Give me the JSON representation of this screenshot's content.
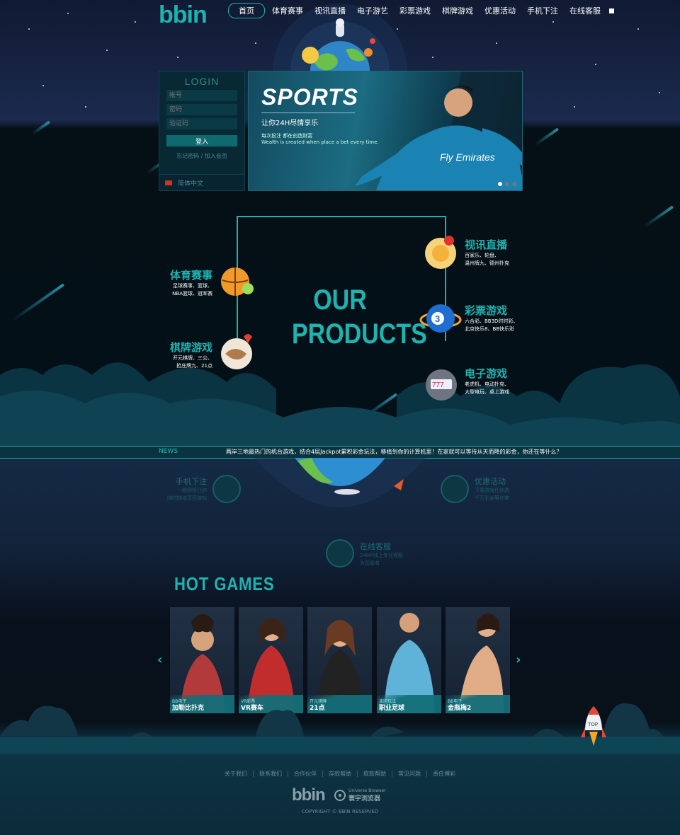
{
  "header": {
    "logo_text": "bbin",
    "nav": [
      "首页",
      "体育赛事",
      "视讯直播",
      "电子游艺",
      "彩票游戏",
      "棋牌游戏",
      "优惠活动",
      "手机下注",
      "在线客服"
    ]
  },
  "login": {
    "title": "LOGIN",
    "account_placeholder": "帐号",
    "password_placeholder": "密码",
    "captcha_placeholder": "验证码",
    "submit_label": "登入",
    "links": "忘记密码 / 加入会员",
    "language": "简体中文"
  },
  "banner": {
    "title": "SPORTS",
    "subtitle": "让你24H尽情享乐",
    "line1": "每次投注 都在创造财富",
    "line2": "Wealth is created when place a bet every time.",
    "shirt_text": "Fly Emirates"
  },
  "products": {
    "heading_line1": "OUR",
    "heading_line2": "PRODUCTS",
    "sports": {
      "title": "体育赛事",
      "desc1": "足球赛事、篮球、",
      "desc2": "NBA篮球、冠军赛"
    },
    "chess": {
      "title": "棋牌游戏",
      "desc1": "开元棋牌、三公、",
      "desc2": "抢庄牌九、21点"
    },
    "live": {
      "title": "视讯直播",
      "desc1": "百家乐、轮盘、",
      "desc2": "温州牌九、德州扑克"
    },
    "lottery": {
      "title": "彩票游戏",
      "desc1": "六合彩、BB3D时时彩、",
      "desc2": "北京快乐8、BB快乐彩"
    },
    "egame": {
      "title": "电子游戏",
      "desc1": "老虎机、电动扑克、",
      "desc2": "大型电玩、桌上游戏"
    }
  },
  "news": {
    "label": "NEWS",
    "text": "两岸三地最热门的机台游戏，结合4层Jackpot累积彩金玩法，移植到你的计算机里！在家就可以等待从天而降的彩金，你还在等什么？"
  },
  "features": {
    "mobile": {
      "title": "手机下注",
      "desc1": "一触即投让你",
      "desc2": "随时随地享受游戏"
    },
    "promo": {
      "title": "优惠活动",
      "desc1": "下载游戏任你选",
      "desc2": "千万彩金等你拿"
    },
    "service": {
      "title": "在线客服",
      "desc1": "24HR线上专业客服",
      "desc2": "为您服务"
    }
  },
  "hot_games": {
    "heading": "HOT GAMES",
    "cards": [
      {
        "sub": "BB电子",
        "name": "加勒比扑克"
      },
      {
        "sub": "VR彩票",
        "name": "VR赛车"
      },
      {
        "sub": "开元棋牌",
        "name": "21点"
      },
      {
        "sub": "波胆玩法",
        "name": "职业足球"
      },
      {
        "sub": "BB电子",
        "name": "金瓶梅2"
      }
    ]
  },
  "rocket_label": "TOP",
  "footer": {
    "links": [
      "关于我们",
      "联系我们",
      "合作伙伴",
      "存款帮助",
      "取款帮助",
      "常见问题",
      "责任博彩"
    ],
    "logo": "bbin",
    "browser_en": "Universe Browser",
    "browser_cn": "寰宇浏览器",
    "copyright": "COPYRIGHT © BBIN RESERVED"
  },
  "colors": {
    "accent": "#1fb3b0",
    "dark": "#041018"
  }
}
